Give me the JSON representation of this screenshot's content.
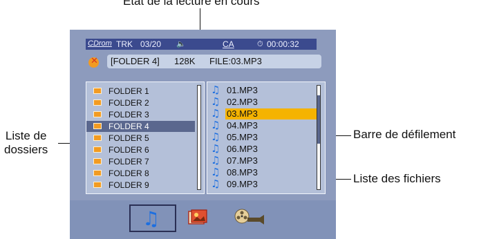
{
  "annotations": {
    "top_label": "Etat de la lecture en cours",
    "folders_label_line1": "Liste de",
    "folders_label_line2": "dossiers",
    "scrollbar_label": "Barre de défilement",
    "files_label": "Liste des fichiers"
  },
  "status": {
    "media": "CDrom",
    "track_label": "TRK",
    "track": "03/20",
    "audio_glyph": "🔈",
    "ca": "CA",
    "time_glyph": "⏱",
    "time": "00:00:32"
  },
  "info": {
    "folder": "[FOLDER 4]",
    "bitrate": "128K",
    "file": "FILE:03.MP3"
  },
  "folders": [
    {
      "label": "FOLDER 1",
      "selected": false
    },
    {
      "label": "FOLDER 2",
      "selected": false
    },
    {
      "label": "FOLDER 3",
      "selected": false
    },
    {
      "label": "FOLDER 4",
      "selected": true
    },
    {
      "label": "FOLDER 5",
      "selected": false
    },
    {
      "label": "FOLDER 6",
      "selected": false
    },
    {
      "label": "FOLDER 7",
      "selected": false
    },
    {
      "label": "FOLDER 8",
      "selected": false
    },
    {
      "label": "FOLDER 9",
      "selected": false
    }
  ],
  "files": [
    {
      "label": "01.MP3",
      "selected": false
    },
    {
      "label": "02.MP3",
      "selected": false
    },
    {
      "label": "03.MP3",
      "selected": true
    },
    {
      "label": "04.MP3",
      "selected": false
    },
    {
      "label": "05.MP3",
      "selected": false
    },
    {
      "label": "06.MP3",
      "selected": false
    },
    {
      "label": "07.MP3",
      "selected": false
    },
    {
      "label": "08.MP3",
      "selected": false
    },
    {
      "label": "09.MP3",
      "selected": false
    }
  ],
  "icons": {
    "close": "close-icon",
    "folder": "folder-icon",
    "file": "music-note-icon",
    "tab_music": "music-note-icon",
    "tab_photo": "photo-icon",
    "tab_video": "film-reel-icon"
  },
  "colors": {
    "panel": "#b4c0d9",
    "status_bar": "#3b4a8e",
    "selected_file": "#f5b300",
    "selected_folder": "#5a678e"
  }
}
